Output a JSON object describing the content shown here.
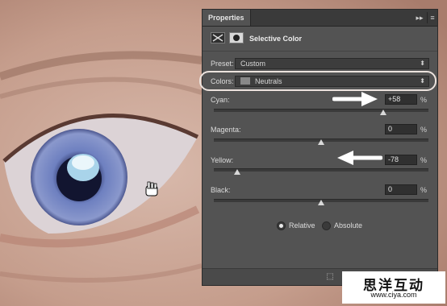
{
  "panel": {
    "tab_label": "Properties",
    "collapse_icon": "double-chevron-right-icon",
    "menu_icon": "panel-menu-icon",
    "adjustment_title": "Selective Color",
    "preset": {
      "label": "Preset:",
      "value": "Custom"
    },
    "colors": {
      "label": "Colors:",
      "value": "Neutrals"
    },
    "sliders": [
      {
        "label": "Cyan:",
        "value": "+58",
        "unit": "%",
        "level": 0.79
      },
      {
        "label": "Magenta:",
        "value": "0",
        "unit": "%",
        "level": 0.5
      },
      {
        "label": "Yellow:",
        "value": "-78",
        "unit": "%",
        "level": 0.11
      },
      {
        "label": "Black:",
        "value": "0",
        "unit": "%",
        "level": 0.5
      }
    ],
    "method": {
      "options": [
        "Relative",
        "Absolute"
      ],
      "selected": "Relative"
    }
  },
  "watermark": {
    "title": "思洋互动",
    "url": "www.ciya.com"
  },
  "colors": {
    "panel_bg": "#535353",
    "highlight_outline": "#ece3de",
    "iris": "#7f8fc4"
  }
}
